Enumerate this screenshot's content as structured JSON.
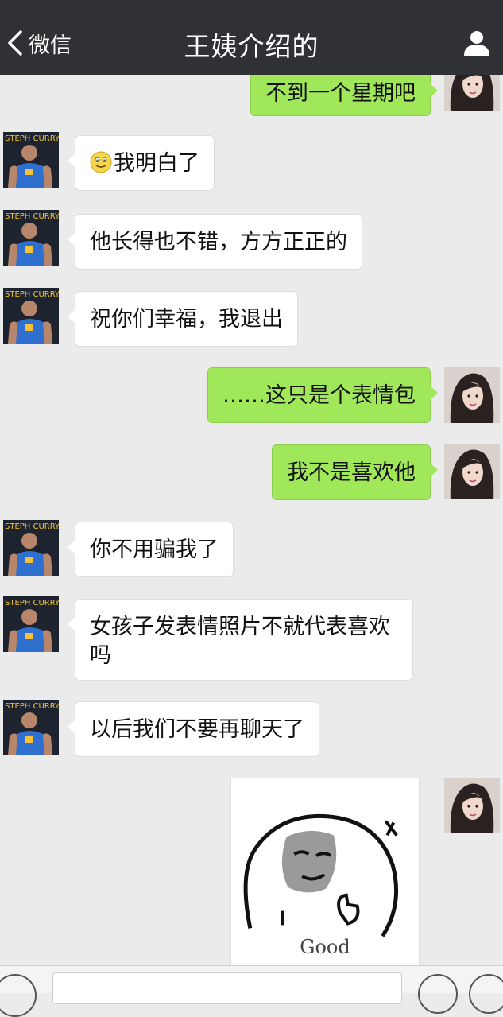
{
  "header": {
    "back_label": "微信",
    "title": "王姨介绍的"
  },
  "avatars": {
    "contact": "curry-avatar-icon",
    "self": "girl-avatar-icon"
  },
  "messages": [
    {
      "side": "out",
      "text": "不到一个星期吧"
    },
    {
      "side": "in",
      "text": "我明白了",
      "emoji": "smile-emoji"
    },
    {
      "side": "in",
      "text": "他长得也不错，方方正正的"
    },
    {
      "side": "in",
      "text": "祝你们幸福，我退出"
    },
    {
      "side": "out",
      "text": "……这只是个表情包"
    },
    {
      "side": "out",
      "text": "我不是喜欢他"
    },
    {
      "side": "in",
      "text": "你不用骗我了"
    },
    {
      "side": "in",
      "text": "女孩子发表情照片不就代表喜欢吗"
    },
    {
      "side": "in",
      "text": "以后我们不要再聊天了"
    },
    {
      "side": "out",
      "type": "sticker",
      "text": "Good"
    }
  ],
  "colors": {
    "topbar": "#2f3135",
    "outgoing_bubble": "#a0e75a",
    "incoming_bubble": "#ffffff",
    "background": "#ebebeb"
  }
}
